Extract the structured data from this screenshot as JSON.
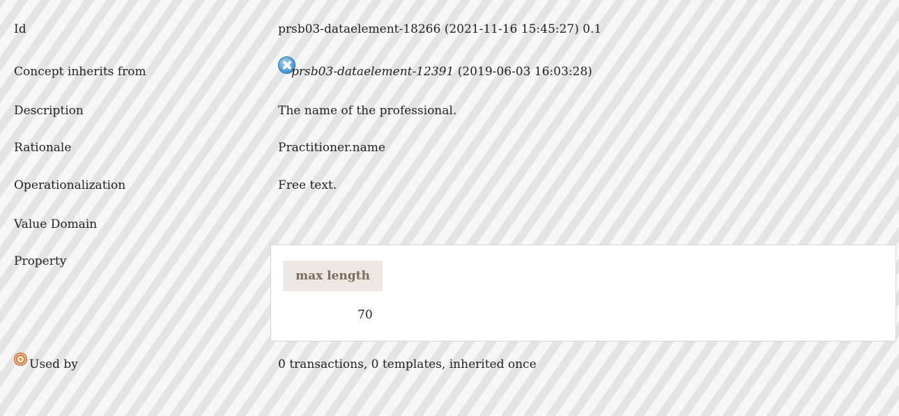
{
  "rows": {
    "id": {
      "label": "Id",
      "value": "prsb03-dataelement-18266 (2021-11-16 15:45:27) 0.1"
    },
    "inherits": {
      "label": "Concept inherits from",
      "link": "prsb03-dataelement-12391",
      "date": "(2019-06-03 16:03:28)",
      "icon": "close-circle-icon"
    },
    "description": {
      "label": "Description",
      "value": "The name of the professional."
    },
    "rationale": {
      "label": "Rationale",
      "value": "Practitioner.name"
    },
    "operationalization": {
      "label": "Operationalization",
      "value": "Free text."
    },
    "value_domain": {
      "label": "Value Domain"
    },
    "property": {
      "label": "Property",
      "header": "max length",
      "value": "70"
    },
    "used_by": {
      "label": "Used by",
      "value": "0 transactions, 0 templates, inherited once",
      "icon": "target-icon"
    }
  },
  "colors": {
    "property_header_bg": "#ece7e2",
    "property_header_text": "#7a6b5f",
    "inherit_icon": "#4d9fdb",
    "used_by_icon": "#e8772a"
  }
}
